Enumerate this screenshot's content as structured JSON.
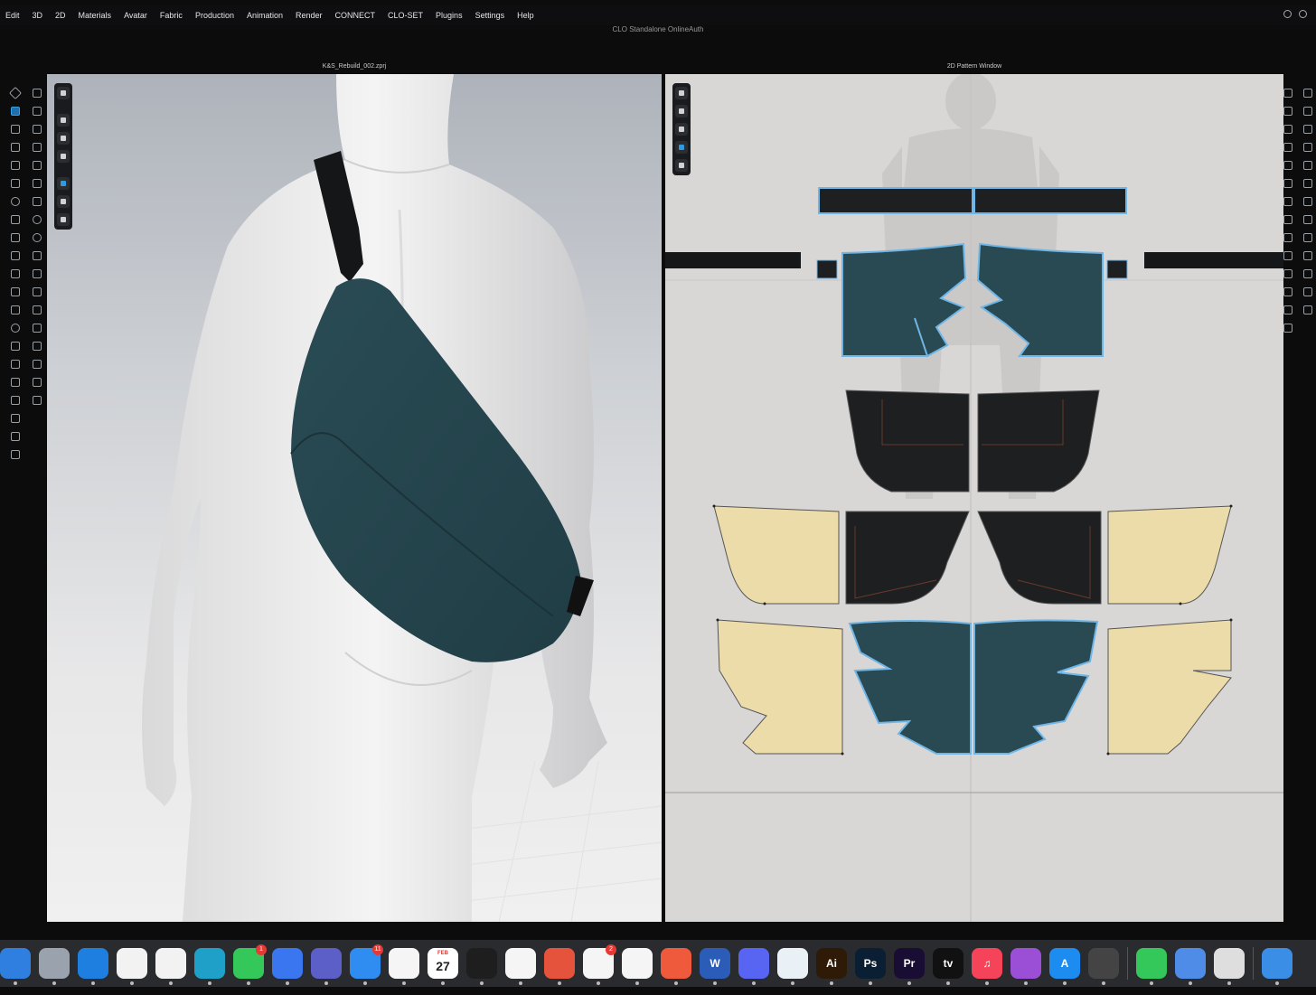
{
  "menubar": {
    "items": [
      "Edit",
      "3D",
      "2D",
      "Materials",
      "Avatar",
      "Fabric",
      "Production",
      "Animation",
      "Render",
      "CONNECT",
      "CLO-SET",
      "Plugins",
      "Settings",
      "Help"
    ]
  },
  "window": {
    "title": "CLO Standalone OnlineAuth"
  },
  "panels": {
    "view3d_title": "K&S_Rebuild_002.zprj",
    "view2d_title": "2D Pattern Window"
  },
  "colors": {
    "fabric_teal": "#294a53",
    "fabric_black": "#1e1f21",
    "fabric_cream": "#ecdcaa",
    "selection_blue": "#6fb6e6",
    "pattern_bg": "#d9d6d6"
  },
  "dock": {
    "apps": [
      {
        "name": "finder-icon",
        "label": "",
        "color": "#2f7fe0"
      },
      {
        "name": "launchpad-icon",
        "label": "",
        "color": "#9aa3ad"
      },
      {
        "name": "safari-icon",
        "label": "",
        "color": "#1e7fe0"
      },
      {
        "name": "pixelmator-icon",
        "label": "",
        "color": "#f2f2f2"
      },
      {
        "name": "chrome-icon",
        "label": "",
        "color": "#f2f2f2"
      },
      {
        "name": "edge-icon",
        "label": "",
        "color": "#1fa0c8"
      },
      {
        "name": "messages-icon",
        "label": "",
        "color": "#34c759",
        "badge": "1"
      },
      {
        "name": "signal-icon",
        "label": "",
        "color": "#3a76f0"
      },
      {
        "name": "teams-icon",
        "label": "",
        "color": "#5b5fc7"
      },
      {
        "name": "mail-icon",
        "label": "",
        "color": "#2f8cf0",
        "badge": "11"
      },
      {
        "name": "photos-icon",
        "label": "",
        "color": "#f5f5f5"
      },
      {
        "name": "calendar-icon",
        "label": "27",
        "sub": "FEB",
        "color": "#ffffff"
      },
      {
        "name": "figma-icon",
        "label": "",
        "color": "#1e1e1e"
      },
      {
        "name": "freeform-icon",
        "label": "",
        "color": "#f5f5f5"
      },
      {
        "name": "taska-icon",
        "label": "",
        "color": "#e5533c"
      },
      {
        "name": "creative-cloud-icon",
        "label": "",
        "color": "#f5f5f5",
        "badge": "2"
      },
      {
        "name": "chatgpt-icon",
        "label": "",
        "color": "#f5f5f5"
      },
      {
        "name": "tabs-icon",
        "label": "",
        "color": "#ef5a3c"
      },
      {
        "name": "word-icon",
        "label": "W",
        "color": "#2b5cb8"
      },
      {
        "name": "discord-icon",
        "label": "",
        "color": "#5865f2"
      },
      {
        "name": "clo-icon",
        "label": "",
        "color": "#e9f1f7"
      },
      {
        "name": "illustrator-icon",
        "label": "Ai",
        "color": "#2e1a06"
      },
      {
        "name": "photoshop-icon",
        "label": "Ps",
        "color": "#0a1f33"
      },
      {
        "name": "premiere-icon",
        "label": "Pr",
        "color": "#1a0d33"
      },
      {
        "name": "appletv-icon",
        "label": "tv",
        "color": "#111111"
      },
      {
        "name": "music-icon",
        "label": "♫",
        "color": "#f5435a"
      },
      {
        "name": "podcasts-icon",
        "label": "",
        "color": "#9b4fd6"
      },
      {
        "name": "appstore-icon",
        "label": "A",
        "color": "#1d8cf0"
      },
      {
        "name": "disk-utility-icon",
        "label": "",
        "color": "#444"
      },
      {
        "name": "facetime-icon",
        "label": "",
        "color": "#34c759"
      },
      {
        "name": "setapp-icon",
        "label": "",
        "color": "#4e8ce8"
      },
      {
        "name": "calculator-icon",
        "label": "",
        "color": "#dedede"
      },
      {
        "name": "folder-icon",
        "label": "",
        "color": "#3a8ee6"
      }
    ]
  }
}
